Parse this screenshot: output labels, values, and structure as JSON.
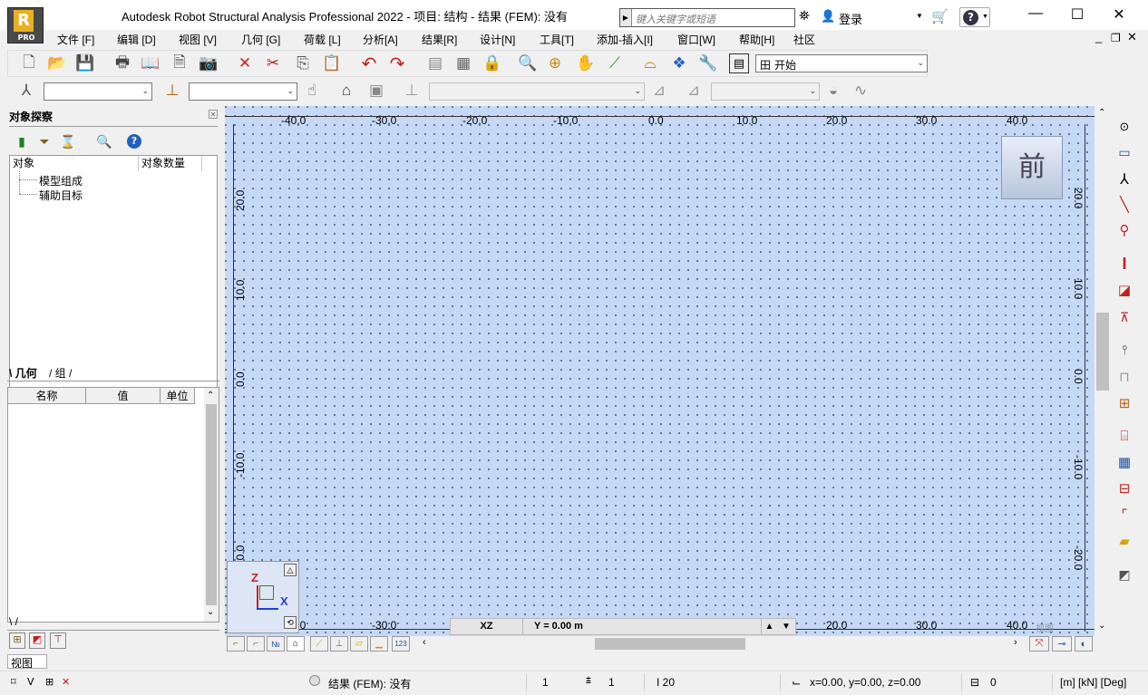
{
  "app": {
    "title": "Autodesk Robot Structural Analysis Professional 2022 - 项目: 结构 -  结果 (FEM): 没有",
    "logo_letter": "R",
    "logo_badge": "PRO",
    "search_placeholder": "键入关键字或短语",
    "login_label": "登录",
    "window_controls": {
      "minimize": "—",
      "restore": "☐",
      "close": "✕"
    },
    "mdi_controls": {
      "minimize": "_",
      "restore": "❐",
      "close": "✕"
    }
  },
  "menu": {
    "items": [
      "文件 [F]",
      "编辑 [D]",
      "视图 [V]",
      "几何 [G]",
      "荷载 [L]",
      "分析[A]",
      "结果[R]",
      "设计[N]",
      "工具[T]",
      "添加-插入[I]",
      "窗口[W]",
      "帮助[H]",
      "社区"
    ]
  },
  "toolbar": {
    "layout_select": "开始",
    "layout_icon": "田"
  },
  "object_inspector": {
    "title": "对象探察",
    "col_object": "对象",
    "col_count": "对象数量",
    "tree": [
      "模型组成",
      "辅助目标"
    ],
    "tabs": [
      "几何",
      "组"
    ],
    "prop_cols": [
      "名称",
      "值",
      "单位"
    ]
  },
  "viewport": {
    "top_ticks": [
      "-40.0",
      "-30.0",
      "-20.0",
      "-10.0",
      "0.0",
      "10.0",
      "20.0",
      "30.0",
      "40.0"
    ],
    "bottom_ticks": [
      "-40.0",
      "-30.0",
      "",
      "",
      "",
      "",
      "20.0",
      "30.0",
      "40.0"
    ],
    "side_ticks": [
      "20.0",
      "10.0",
      "0.0",
      "-10.0",
      "-20.0"
    ],
    "viewcube_label": "前",
    "axis_z": "Z",
    "axis_x": "X",
    "plane_label": "XZ",
    "plane_coord": "Y = 0.00 m",
    "corner_label": "视图"
  },
  "view_tab": "视图",
  "status": {
    "results": "结果 (FEM): 没有",
    "field1": "1",
    "field2": "1",
    "field3": "I 20",
    "coords": "x=0.00, y=0.00, z=0.00",
    "field4": "0",
    "units": "[m] [kN] [Deg]"
  },
  "colors": {
    "viewport_bg": "#c5d9f7",
    "axis_z": "#d02020",
    "axis_x": "#2040d0"
  }
}
